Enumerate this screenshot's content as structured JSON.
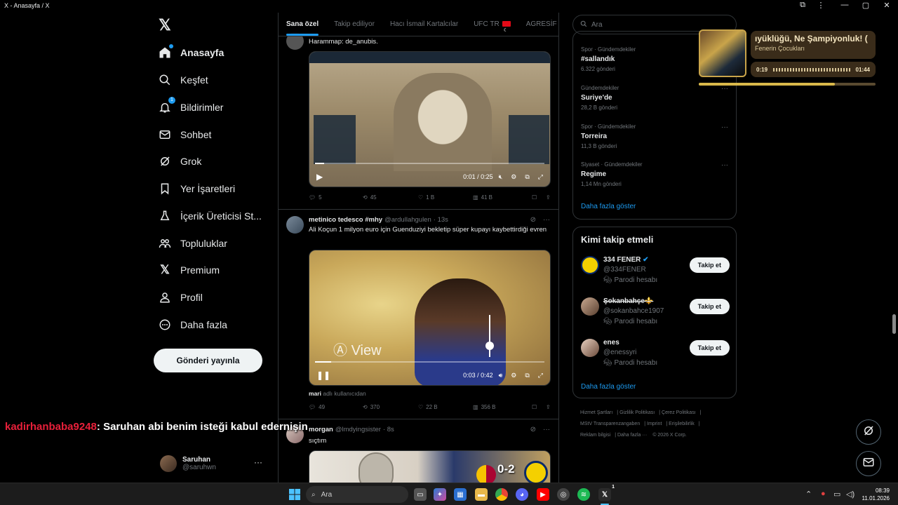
{
  "window": {
    "title": "X - Anasayfa / X",
    "min": "—",
    "max": "▢",
    "close": "✕"
  },
  "nav": {
    "items": [
      {
        "label": "Anasayfa"
      },
      {
        "label": "Keşfet"
      },
      {
        "label": "Bildirimler",
        "badge": "1"
      },
      {
        "label": "Sohbet"
      },
      {
        "label": "Grok"
      },
      {
        "label": "Yer İşaretleri"
      },
      {
        "label": "İçerik Üreticisi St..."
      },
      {
        "label": "Topluluklar"
      },
      {
        "label": "Premium"
      },
      {
        "label": "Profil"
      },
      {
        "label": "Daha fazla"
      }
    ],
    "post_button": "Gönderi yayınla",
    "me": {
      "name": "Saruhan",
      "handle": "@saruhwn",
      "more": "···"
    }
  },
  "feed": {
    "tabs": [
      "Sana özel",
      "Takip ediliyor",
      "Hacı İsmail Kartalcılar",
      "UFC TR",
      "AGRESİF"
    ],
    "tweet1": {
      "text": "Harammap: de_anubis.",
      "video_time": "0:01 / 0:25",
      "progress": 0.04,
      "stats": {
        "replies": "5",
        "reposts": "45",
        "likes": "1 B",
        "views": "41 B"
      }
    },
    "tweet2": {
      "name": "metinico tedesco #mhy",
      "handle": "@ardullahgulen",
      "time": "· 13s",
      "text": "Ali Koçun 1 milyon euro için Guenduziyi bekletip süper kupayı kaybettirdiği evren",
      "video_time": "0:03 / 0:42",
      "progress": 0.07,
      "media_overlay": "View",
      "credit_user": "mari",
      "credit_text": "adlı kullanıcıdan",
      "stats": {
        "replies": "49",
        "reposts": "370",
        "likes": "22 B",
        "views": "356 B"
      }
    },
    "tweet3": {
      "name": "morgan",
      "handle": "@lmdyingsister",
      "time": "· 8s",
      "text": "sıçtım",
      "score": "0-2"
    }
  },
  "right": {
    "search_placeholder": "Ara",
    "trends": [
      {
        "category": "Spor · Gündemdekiler",
        "name": "#sallandık",
        "count": "6.322 gönderi"
      },
      {
        "category": "Gündemdekiler",
        "name": "Suriye'de",
        "count": "28,2 B gönderi"
      },
      {
        "category": "Spor · Gündemdekiler",
        "name": "Torreira",
        "count": "11,3 B gönderi"
      },
      {
        "category": "Siyaset · Gündemdekiler",
        "name": "Regime",
        "count": "1,14 Mn gönderi"
      }
    ],
    "show_more": "Daha fazla göster",
    "wtf_title": "Kimi takip etmeli",
    "follow_label": "Takip et",
    "parody": "Parodi hesabı",
    "suggestions": [
      {
        "name": "334 FENER",
        "handle": "@334FENER"
      },
      {
        "name": "Şokanbahçe⚜️",
        "handle": "@sokanbahce1907"
      },
      {
        "name": "enes",
        "handle": "@enessyri"
      }
    ],
    "footer": [
      "Hizmet Şartları",
      "Gizlilik Politikası",
      "Çerez Politikası",
      "MStV Transparenzangaben",
      "Imprint",
      "Erişilebilirlik",
      "Reklam bilgisi",
      "Daha fazla ···",
      "© 2026 X Corp."
    ]
  },
  "music": {
    "song": "ıyüklüğü, Ne Şampiyonluk! (",
    "artist": "Fenerin Çocukları",
    "elapsed": "0:19",
    "total": "01:44",
    "progress": 0.77
  },
  "chat": {
    "user": "kadirhanbaba9248",
    "message": ": Saruhan abi benim isteği kabul edernişin"
  },
  "taskbar": {
    "search": "Ara",
    "time": "08:39",
    "date": "11.01.2026",
    "badge": "1"
  }
}
